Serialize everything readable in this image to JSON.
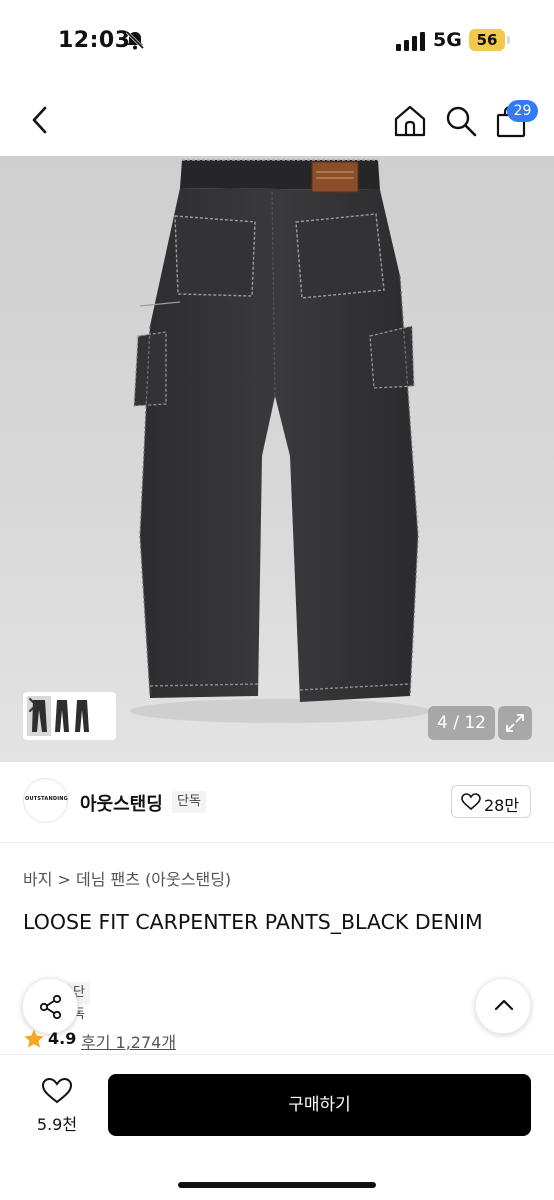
{
  "status_bar": {
    "time": "12:03",
    "network": "5G",
    "battery": "56"
  },
  "nav": {
    "cart_count": "29"
  },
  "gallery": {
    "counter": "4 / 12"
  },
  "brand": {
    "logo_text": "OUTSTANDING",
    "name": "아웃스탠딩",
    "tag": "단독",
    "likes": "28만"
  },
  "product": {
    "breadcrumb": "바지 > 데님 팬츠 (아웃스탠딩)",
    "title": "LOOSE FIT CARPENTER PANTS_BLACK DENIM",
    "tag": "단독",
    "rating": "4.9",
    "reviews": "후기 1,274개"
  },
  "bottom": {
    "wish_count": "5.9천",
    "buy_label": "구매하기"
  },
  "colors": {
    "accent_badge": "#2f7cf6",
    "battery": "#f2c94c",
    "star": "#f5a623",
    "buy_button": "#000000"
  }
}
